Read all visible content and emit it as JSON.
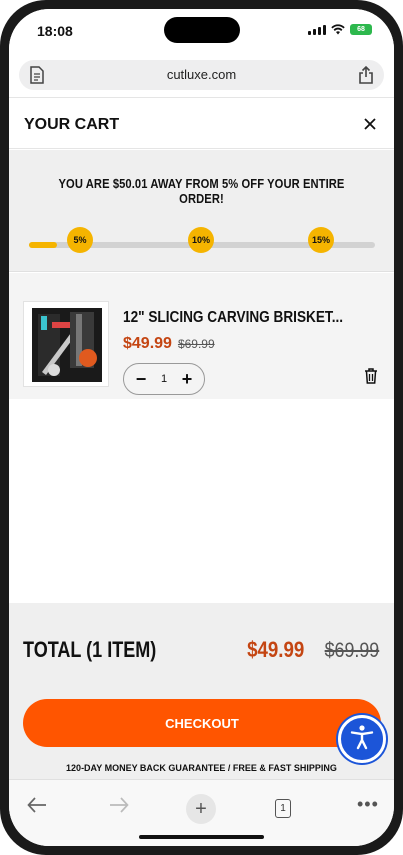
{
  "status_bar": {
    "time": "18:08",
    "battery": "68"
  },
  "address_bar": {
    "url": "cutluxe.com"
  },
  "cart": {
    "title": "YOUR CART",
    "promo": {
      "message": "YOU ARE $50.01 AWAY FROM 5% OFF YOUR ENTIRE ORDER!",
      "progress_fraction": 0.08,
      "milestones": [
        "5%",
        "10%",
        "15%"
      ],
      "colors": {
        "fill": "#f5b400",
        "track": "#d2d2d2"
      }
    },
    "items": [
      {
        "name": "12\" SLICING CARVING BRISKET...",
        "sale_price": "$49.99",
        "original_price": "$69.99",
        "quantity": "1"
      }
    ],
    "summary": {
      "total_label": "TOTAL (1 ITEM)",
      "total_sale": "$49.99",
      "total_original": "$69.99",
      "checkout_label": "CHECKOUT",
      "guarantee": "120-DAY MONEY BACK GUARANTEE / FREE & FAST SHIPPING"
    }
  },
  "browser_toolbar": {
    "tab_count": "1"
  },
  "colors": {
    "accent": "#ff5500",
    "sale_price": "#c44512",
    "accessibility": "#1c55d8"
  },
  "icons": [
    "document-icon",
    "share-icon",
    "close-icon",
    "trash-icon",
    "accessibility-icon",
    "back-arrow-icon",
    "forward-arrow-icon",
    "plus-icon",
    "tabs-icon",
    "more-icon"
  ]
}
